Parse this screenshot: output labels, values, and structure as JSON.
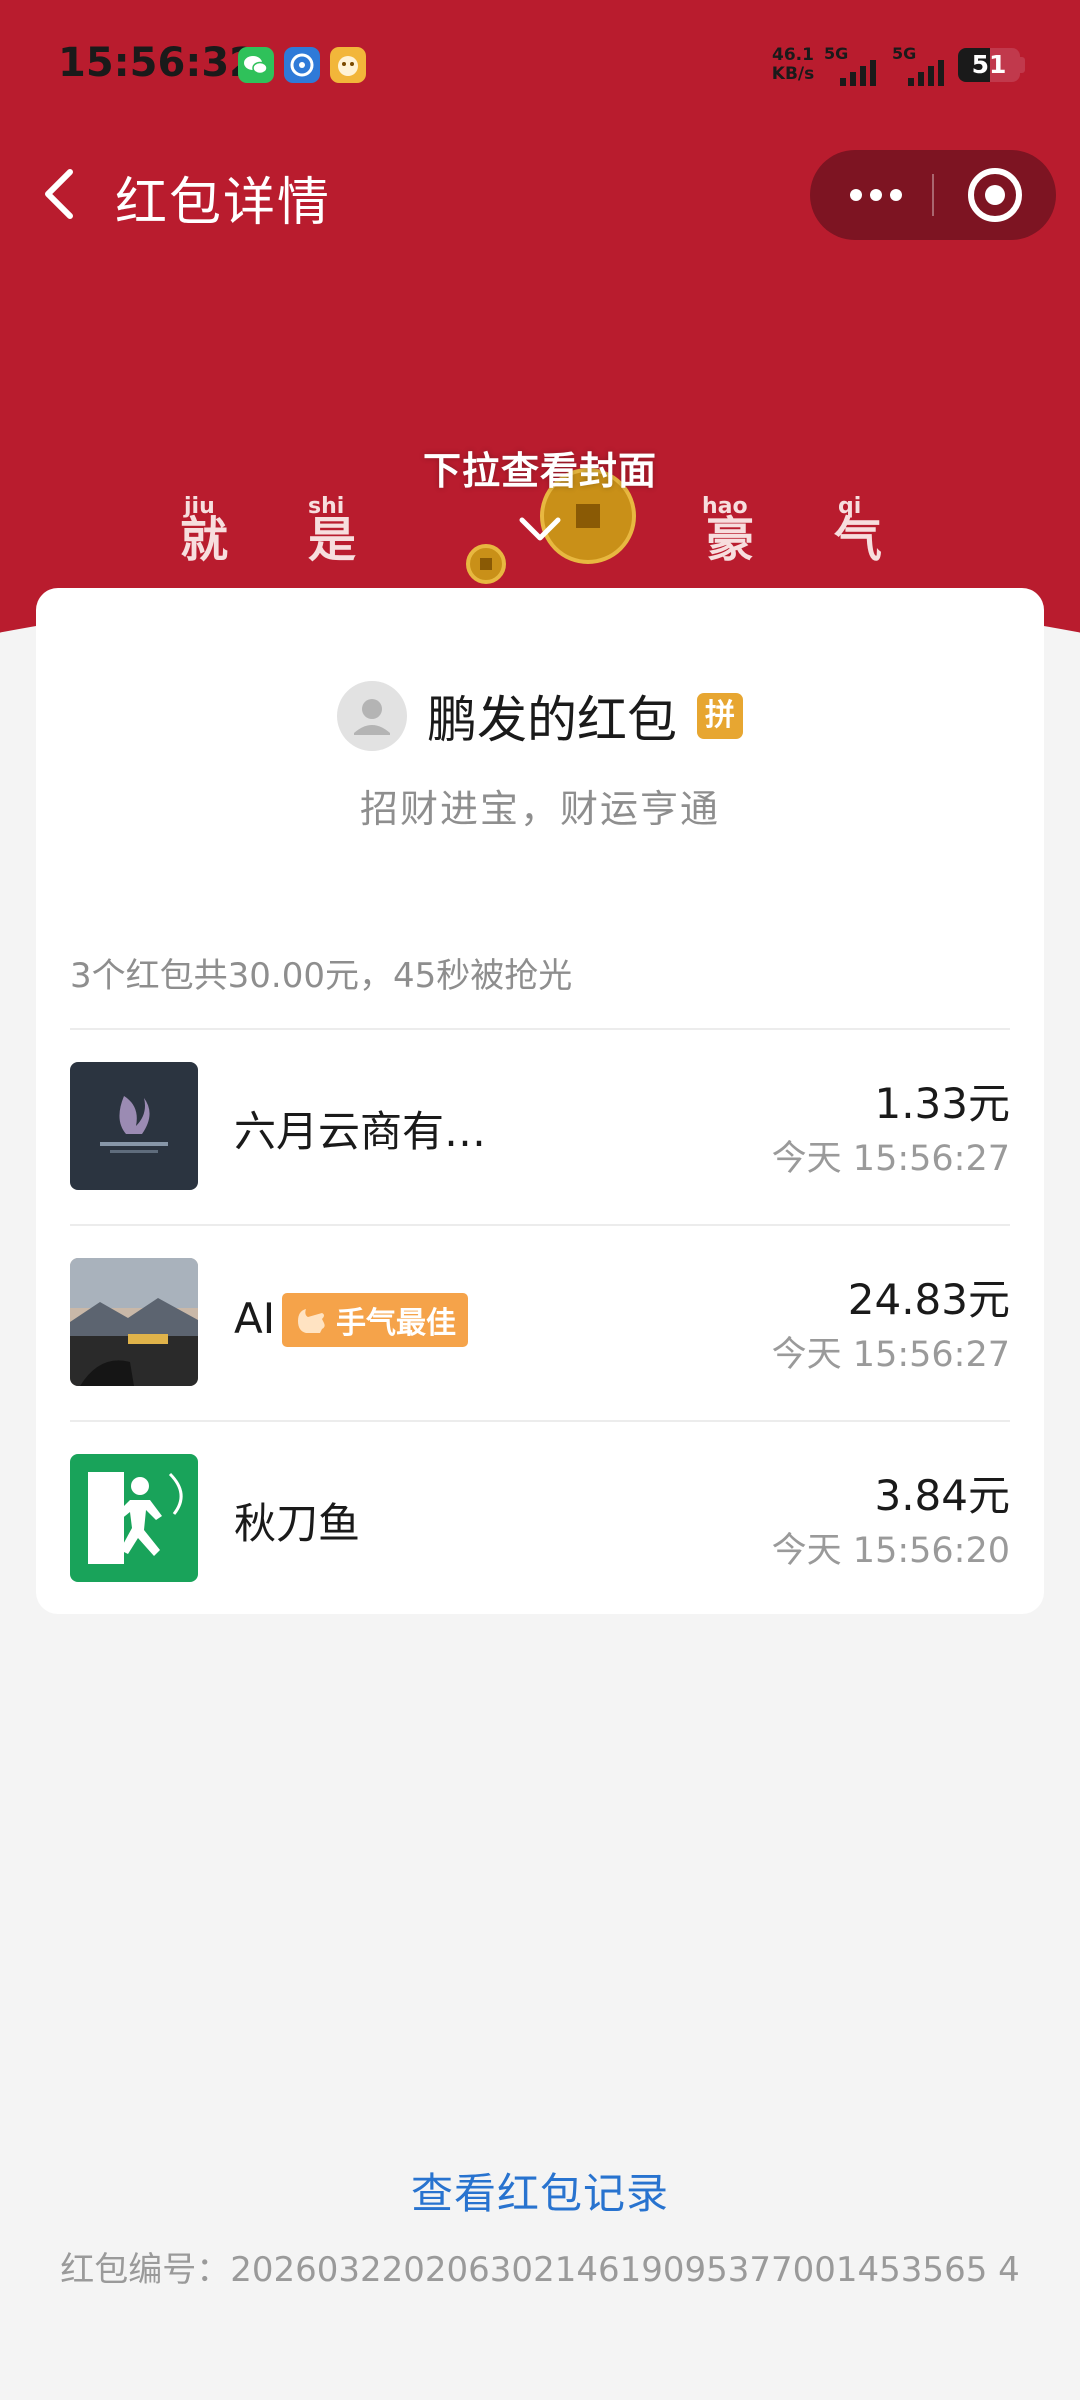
{
  "status_bar": {
    "time": "15:56:32",
    "net_speed_value": "46.1",
    "net_speed_unit": "KB/s",
    "signal1_label": "5G",
    "signal2_label": "5G",
    "battery_level": "51",
    "battery_fraction": 0.51,
    "notification_icons": [
      "wechat-icon",
      "app-blue-icon",
      "app-yellow-icon"
    ]
  },
  "nav": {
    "title": "红包详情",
    "back_icon": "chevron-left-icon",
    "more_icon": "more-dots-icon",
    "close_icon": "target-close-icon"
  },
  "cover": {
    "hint": "下拉查看封面",
    "chars": [
      {
        "pinyin": "jiu",
        "char": "就"
      },
      {
        "pinyin": "shi",
        "char": "是"
      },
      {
        "pinyin": "hao",
        "char": "豪"
      },
      {
        "pinyin": "qi",
        "char": "气"
      }
    ]
  },
  "packet": {
    "sender_title": "鹏发的红包",
    "tag": "拼",
    "blessing": "招财进宝，财运亨通"
  },
  "summary": "3个红包共30.00元，45秒被抢光",
  "records": [
    {
      "name": "六月云商有…",
      "amount": "1.33元",
      "time": "今天 15:56:27",
      "best": false
    },
    {
      "name": "AI",
      "amount": "24.83元",
      "time": "今天 15:56:27",
      "best": true,
      "best_label": "手气最佳"
    },
    {
      "name": "秋刀鱼",
      "amount": "3.84元",
      "time": "今天 15:56:20",
      "best": false
    }
  ],
  "footer": {
    "record_link": "查看红包记录",
    "serial": "红包编号：20260322020630214619095377001453565 4"
  },
  "colors": {
    "header_red": "#b91c2e",
    "link_blue": "#2873cf",
    "best_orange": "#f5a34a"
  }
}
